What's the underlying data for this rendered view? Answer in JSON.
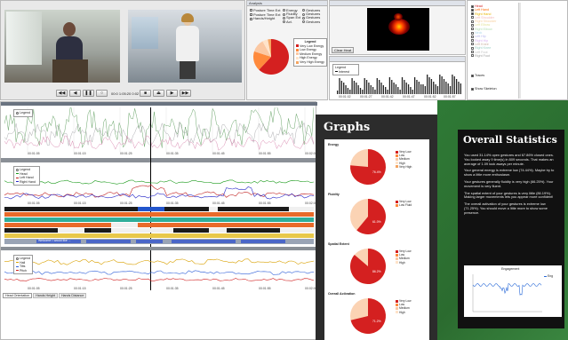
{
  "video": {
    "time": "00:0 1:05:20 0:02"
  },
  "analysis": {
    "title": "Analysis",
    "checks": [
      "Posture Time Ext",
      "Posture Time Ext",
      "Hands/Height"
    ],
    "radios_a": [
      "Energy",
      "Fluidity",
      "Span Ext",
      "Act."
    ],
    "radios_b": [
      "Gestures",
      "Gestures",
      "Gestures",
      "Gestures"
    ],
    "legend_title": "Legend",
    "legend": [
      {
        "label": "Very Low Energy",
        "color": "#d42020"
      },
      {
        "label": "Low Energy",
        "color": "#ff8a3c"
      },
      {
        "label": "Medium Energy",
        "color": "#fbc8a3"
      },
      {
        "label": "High Energy",
        "color": "#ffe3c9"
      },
      {
        "label": "Very High Energy",
        "color": "#f4a460"
      }
    ],
    "pie_values": [
      0.62,
      0.18,
      0.12,
      0.05,
      0.03
    ]
  },
  "heat": {
    "clear_button": "Clear Heat"
  },
  "sparkline": {
    "legend_title": "Legend",
    "legend_item": "Interest",
    "ticks": [
      "00:01:02",
      "00:01:27",
      "00:01:42",
      "00:01:47",
      "00:01:52",
      "00:01:57"
    ]
  },
  "joints": {
    "items": [
      "Head",
      "Left Hand",
      "Right Hand",
      "Left Shoulder",
      "Right Shoulder",
      "Left Elbow",
      "Right Elbow",
      "Neck",
      "Left Hip",
      "Right Hip",
      "Left Knee",
      "Right Knee",
      "Left Foot",
      "Right Foot"
    ],
    "traces_label": "Traces",
    "skeleton_label": "Show Skeleton",
    "colors": [
      "#d42020",
      "#ff6a00",
      "#e8b400",
      "#f2b8b8",
      "#f7d0a0",
      "#e3e39a",
      "#b8e0b8",
      "#b0d8ec",
      "#b8b8f0",
      "#d9b3f0",
      "#c9b0a0",
      "#9ccfc4",
      "#c0c0c0",
      "#a0a0a0"
    ]
  },
  "timeline": {
    "legend_title": "Legend",
    "ticks": [
      "00:01:05",
      "00:01:15",
      "00:01:25",
      "00:01:35",
      "00:01:45",
      "00:01:55",
      "00:02:05"
    ],
    "hands_legend": [
      "Head",
      "Left Hand",
      "Right Hand"
    ],
    "hands_colors": [
      "#1a9a1a",
      "#c02020",
      "#2828c8"
    ],
    "feet_legend": [
      "Hall",
      "Tilts",
      "Pitch"
    ],
    "feet_colors": [
      "#d9a000",
      "#3060d8",
      "#d02020"
    ],
    "speech_bar": "Welcome! I would like ...",
    "tabs": [
      "Head Orientation",
      "Hands Height",
      "Hands Distance"
    ]
  },
  "graphs": {
    "title": "Graphs",
    "sections": [
      {
        "name": "Energy",
        "pct": "76.4%",
        "legend": [
          "Very Low",
          "Low",
          "Medium",
          "High",
          "Very High"
        ]
      },
      {
        "name": "Fluidity",
        "pct": "61.0%",
        "legend": [
          "Very Low",
          "Low Fluid"
        ]
      },
      {
        "name": "Spatial Extent",
        "pct": "86.2%",
        "legend": [
          "Very Low",
          "Low",
          "Medium",
          "High"
        ]
      },
      {
        "name": "Overall Activation",
        "pct": "71.2%",
        "legend": [
          "Very Low",
          "Low",
          "Medium",
          "High"
        ]
      }
    ]
  },
  "stats": {
    "title": "Overall Statistics",
    "paragraphs": [
      "You used 31.14% open gestures and 67.86% closed ones. You looked away 9 time(s) in 809 seconds. That makes an average of 1.09 look aways per minute.",
      "Your general energy is extreme low (74.44%). Maybe try to show a little more enthusiasm.",
      "Your gestures generally fluidity is very high (66.25%). Your movement is very fluent.",
      "The spatial extent of your gestures is very little (86.19%). Making larger movements lets you appear more confident!",
      "The overall activation of your gestures is extreme low (71.25%). You should move a little more to show some presence."
    ],
    "chart_title": "Engagement",
    "chart_legend": "Eng"
  }
}
